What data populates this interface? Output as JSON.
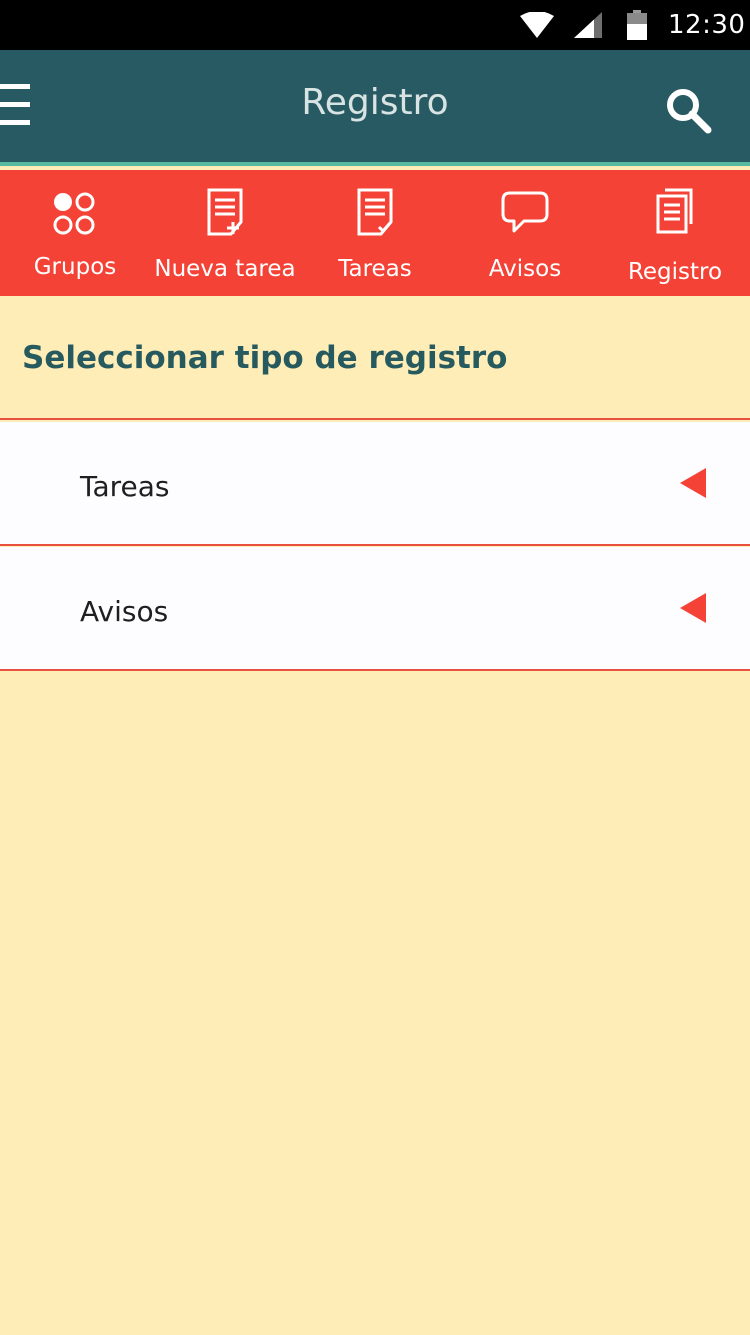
{
  "status_bar": {
    "time": "12:30",
    "icons": [
      "wifi-icon",
      "signal-icon",
      "battery-icon"
    ]
  },
  "app_bar": {
    "title": "Registro",
    "left_icon": "menu-icon",
    "right_icon": "search-icon"
  },
  "tabs": [
    {
      "label": "Grupos",
      "icon": "groups-icon"
    },
    {
      "label": "Nueva tarea",
      "icon": "new-task-icon"
    },
    {
      "label": "Tareas",
      "icon": "tasks-icon"
    },
    {
      "label": "Avisos",
      "icon": "chat-bubble-icon"
    },
    {
      "label": "Registro",
      "icon": "records-icon",
      "selected": true
    }
  ],
  "section": {
    "title": "Seleccionar tipo de registro"
  },
  "list": [
    {
      "label": "Tareas",
      "icon": "triangle-left-icon"
    },
    {
      "label": "Avisos",
      "icon": "triangle-left-icon"
    }
  ],
  "colors": {
    "status_bar": "#000000",
    "app_bar": "#275a62",
    "app_bar_accent": "#58b9a1",
    "tab_bar": "#f44336",
    "background": "#ffedb8",
    "list_background": "#fdfcfe",
    "divider": "#e8513d",
    "section_title": "#265a5e",
    "arrow": "#f44336"
  }
}
